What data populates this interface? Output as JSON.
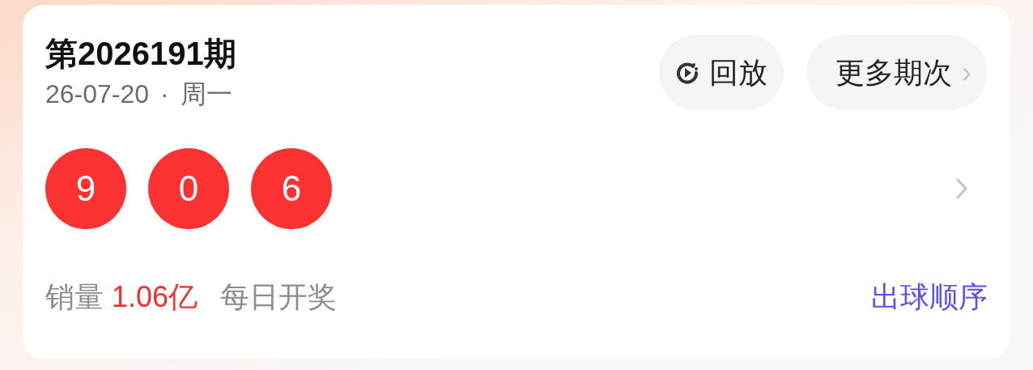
{
  "issue": {
    "title": "第2026191期",
    "date": "26-07-20",
    "separator": "·",
    "weekday": "周一"
  },
  "buttons": [
    {
      "kind": "replay",
      "label": "回放"
    },
    {
      "kind": "more",
      "label": "更多期次",
      "chevron": "›"
    }
  ],
  "balls": [
    "9",
    "0",
    "6"
  ],
  "sales": {
    "label": "销量",
    "value": "1.06亿"
  },
  "frequency": "每日开奖",
  "order_link": "出球顺序"
}
